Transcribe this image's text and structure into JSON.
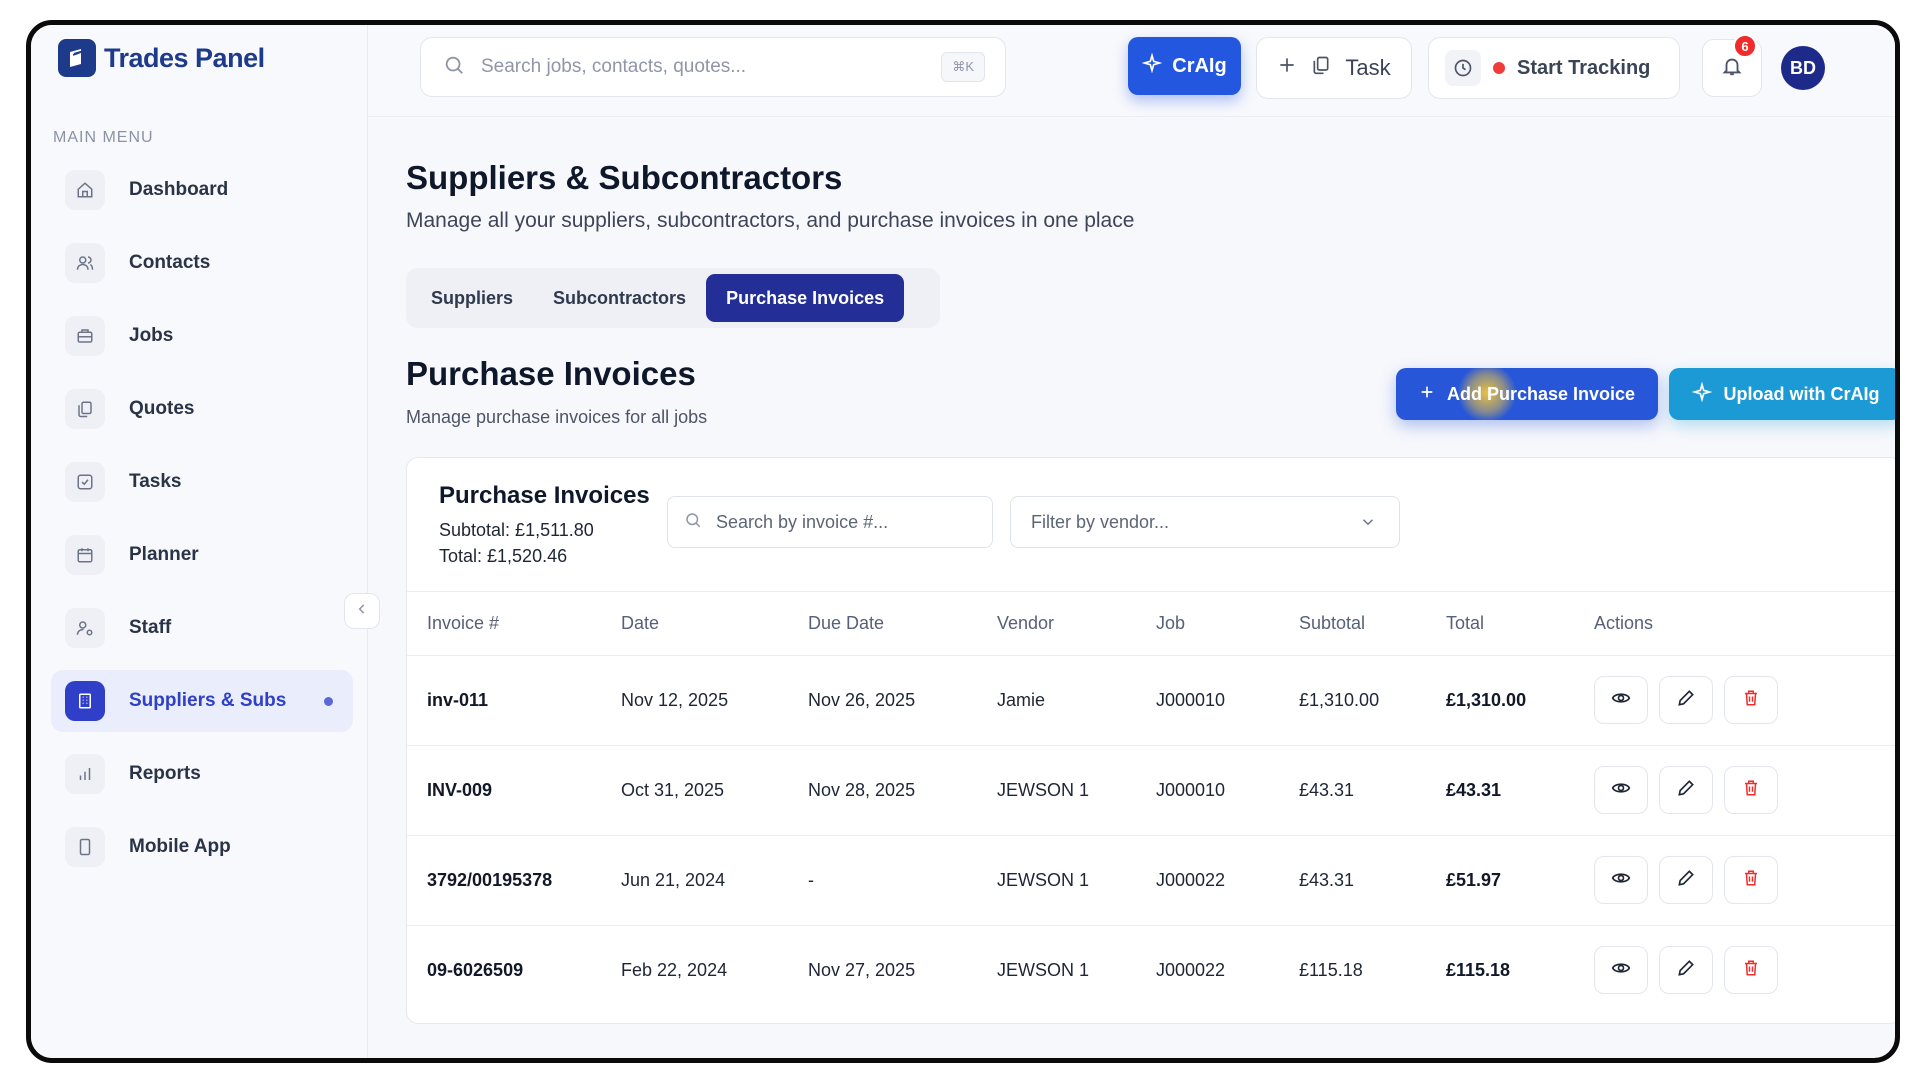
{
  "brand": {
    "name": "Trades Panel"
  },
  "sidebar": {
    "section_label": "MAIN MENU",
    "items": [
      {
        "label": "Dashboard",
        "icon": "home-icon"
      },
      {
        "label": "Contacts",
        "icon": "users-icon"
      },
      {
        "label": "Jobs",
        "icon": "briefcase-icon"
      },
      {
        "label": "Quotes",
        "icon": "documents-icon"
      },
      {
        "label": "Tasks",
        "icon": "check-square-icon"
      },
      {
        "label": "Planner",
        "icon": "calendar-icon"
      },
      {
        "label": "Staff",
        "icon": "user-settings-icon"
      },
      {
        "label": "Suppliers & Subs",
        "icon": "building-icon",
        "active": true
      },
      {
        "label": "Reports",
        "icon": "bar-chart-icon"
      },
      {
        "label": "Mobile App",
        "icon": "smartphone-icon"
      }
    ]
  },
  "topbar": {
    "search_placeholder": "Search jobs, contacts, quotes...",
    "search_shortcut": "⌘K",
    "craig_label": "CrAIg",
    "task_label": "Task",
    "tracking_label": "Start Tracking",
    "notification_count": "6",
    "avatar_initials": "BD"
  },
  "page": {
    "title": "Suppliers & Subcontractors",
    "subtitle": "Manage all your suppliers, subcontractors, and purchase invoices in one place"
  },
  "tabs": [
    {
      "label": "Suppliers",
      "active": false
    },
    {
      "label": "Subcontractors",
      "active": false
    },
    {
      "label": "Purchase Invoices",
      "active": true
    }
  ],
  "section": {
    "title": "Purchase Invoices",
    "subtitle": "Manage purchase invoices for all jobs",
    "add_button": "Add Purchase Invoice",
    "upload_button": "Upload with CrAIg"
  },
  "card": {
    "title": "Purchase Invoices",
    "subtotal": "Subtotal: £1,511.80",
    "total": "Total: £1,520.46",
    "search_placeholder": "Search by invoice #...",
    "vendor_filter_placeholder": "Filter by vendor..."
  },
  "table": {
    "columns": [
      "Invoice #",
      "Date",
      "Due Date",
      "Vendor",
      "Job",
      "Subtotal",
      "Total",
      "Actions"
    ],
    "rows": [
      {
        "invoice": "inv-011",
        "date": "Nov 12, 2025",
        "due": "Nov 26, 2025",
        "vendor": "Jamie",
        "job": "J000010",
        "subtotal": "£1,310.00",
        "total": "£1,310.00"
      },
      {
        "invoice": "INV-009",
        "date": "Oct 31, 2025",
        "due": "Nov 28, 2025",
        "vendor": "JEWSON 1",
        "job": "J000010",
        "subtotal": "£43.31",
        "total": "£43.31"
      },
      {
        "invoice": "3792/00195378",
        "date": "Jun 21, 2024",
        "due": "-",
        "vendor": "JEWSON 1",
        "job": "J000022",
        "subtotal": "£43.31",
        "total": "£51.97"
      },
      {
        "invoice": "09-6026509",
        "date": "Feb 22, 2024",
        "due": "Nov 27, 2025",
        "vendor": "JEWSON 1",
        "job": "J000022",
        "subtotal": "£115.18",
        "total": "£115.18"
      }
    ]
  },
  "colors": {
    "brand": "#1e3a8a",
    "accent": "#2457e0",
    "active_tab": "#232f96",
    "upload": "#1b9ad6",
    "danger": "#ef2b2b"
  }
}
